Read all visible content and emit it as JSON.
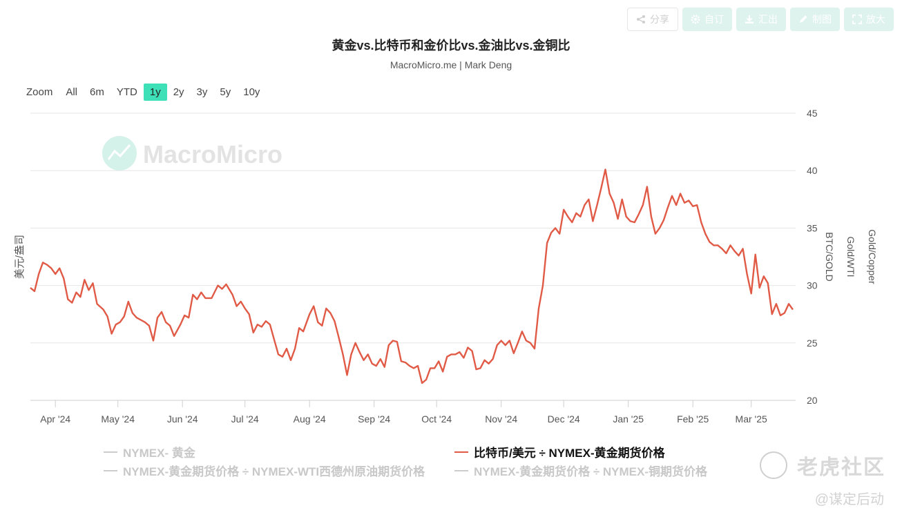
{
  "toolbar": {
    "share": "分享",
    "subscribe": "自订",
    "export": "汇出",
    "edit": "制图",
    "enlarge": "放大"
  },
  "title": "黄金vs.比特币和金价比vs.金油比vs.金铜比",
  "subtitle": "MacroMicro.me | Mark Deng",
  "zoom": {
    "label": "Zoom",
    "options": [
      "All",
      "6m",
      "YTD",
      "1y",
      "2y",
      "3y",
      "5y",
      "10y"
    ],
    "active": "1y"
  },
  "watermark": "MacroMicro",
  "legend": {
    "gold": "NYMEX- 黄金",
    "btc_gold": "比特币/美元 ÷ NYMEX-黄金期货价格",
    "gold_wti": "NYMEX-黄金期货价格 ÷ NYMEX-WTI西德州原油期货价格",
    "gold_copper": "NYMEX-黄金期货价格 ÷ NYMEX-铜期货价格"
  },
  "community": {
    "name": "老虎社区",
    "handle": "@谋定后动"
  },
  "chart_data": {
    "type": "line",
    "ylabel_left": "美元/盎司",
    "ylabels_right": [
      "BTC/GOLD",
      "Gold/WTI",
      "Gold/Copper"
    ],
    "ylim": [
      20,
      45
    ],
    "yticks": [
      20,
      25,
      30,
      35,
      40,
      45
    ],
    "x_ticks": [
      "Apr '24",
      "May '24",
      "Jun '24",
      "Jul '24",
      "Aug '24",
      "Sep '24",
      "Oct '24",
      "Nov '24",
      "Dec '24",
      "Jan '25",
      "Feb '25",
      "Mar '25"
    ],
    "grid": true,
    "line_color": "#e05a46",
    "series": [
      {
        "name": "比特币/美元 ÷ NYMEX-黄金期货价格",
        "points": [
          [
            "2024-03-20",
            29.8
          ],
          [
            "2024-03-22",
            29.5
          ],
          [
            "2024-03-24",
            31.0
          ],
          [
            "2024-03-26",
            32.0
          ],
          [
            "2024-03-28",
            31.8
          ],
          [
            "2024-03-30",
            31.5
          ],
          [
            "2024-04-01",
            31.0
          ],
          [
            "2024-04-03",
            31.5
          ],
          [
            "2024-04-05",
            30.6
          ],
          [
            "2024-04-07",
            28.8
          ],
          [
            "2024-04-09",
            28.5
          ],
          [
            "2024-04-11",
            29.4
          ],
          [
            "2024-04-13",
            29.0
          ],
          [
            "2024-04-15",
            30.5
          ],
          [
            "2024-04-17",
            29.6
          ],
          [
            "2024-04-19",
            30.2
          ],
          [
            "2024-04-21",
            28.4
          ],
          [
            "2024-04-24",
            27.9
          ],
          [
            "2024-04-26",
            27.3
          ],
          [
            "2024-04-28",
            25.8
          ],
          [
            "2024-04-30",
            26.6
          ],
          [
            "2024-05-02",
            26.8
          ],
          [
            "2024-05-04",
            27.3
          ],
          [
            "2024-05-06",
            28.6
          ],
          [
            "2024-05-08",
            27.6
          ],
          [
            "2024-05-10",
            27.2
          ],
          [
            "2024-05-12",
            27.0
          ],
          [
            "2024-05-14",
            26.8
          ],
          [
            "2024-05-16",
            26.5
          ],
          [
            "2024-05-18",
            25.2
          ],
          [
            "2024-05-20",
            27.2
          ],
          [
            "2024-05-22",
            27.7
          ],
          [
            "2024-05-24",
            26.8
          ],
          [
            "2024-05-26",
            26.5
          ],
          [
            "2024-05-28",
            25.6
          ],
          [
            "2024-05-31",
            26.6
          ],
          [
            "2024-06-02",
            27.4
          ],
          [
            "2024-06-04",
            27.2
          ],
          [
            "2024-06-06",
            29.2
          ],
          [
            "2024-06-08",
            28.8
          ],
          [
            "2024-06-10",
            29.4
          ],
          [
            "2024-06-12",
            28.9
          ],
          [
            "2024-06-15",
            28.9
          ],
          [
            "2024-06-18",
            30.0
          ],
          [
            "2024-06-20",
            29.7
          ],
          [
            "2024-06-22",
            30.1
          ],
          [
            "2024-06-25",
            29.2
          ],
          [
            "2024-06-27",
            28.2
          ],
          [
            "2024-06-29",
            28.6
          ],
          [
            "2024-07-01",
            28.0
          ],
          [
            "2024-07-03",
            27.5
          ],
          [
            "2024-07-05",
            25.9
          ],
          [
            "2024-07-07",
            26.6
          ],
          [
            "2024-07-09",
            26.4
          ],
          [
            "2024-07-11",
            26.9
          ],
          [
            "2024-07-13",
            26.6
          ],
          [
            "2024-07-15",
            25.3
          ],
          [
            "2024-07-17",
            24.0
          ],
          [
            "2024-07-19",
            23.8
          ],
          [
            "2024-07-21",
            24.5
          ],
          [
            "2024-07-23",
            23.5
          ],
          [
            "2024-07-25",
            24.5
          ],
          [
            "2024-07-27",
            26.3
          ],
          [
            "2024-07-29",
            26.0
          ],
          [
            "2024-08-01",
            27.5
          ],
          [
            "2024-08-03",
            28.2
          ],
          [
            "2024-08-05",
            26.8
          ],
          [
            "2024-08-07",
            26.5
          ],
          [
            "2024-08-09",
            28.0
          ],
          [
            "2024-08-11",
            27.6
          ],
          [
            "2024-08-13",
            26.9
          ],
          [
            "2024-08-15",
            25.5
          ],
          [
            "2024-08-17",
            24.0
          ],
          [
            "2024-08-19",
            22.2
          ],
          [
            "2024-08-21",
            24.0
          ],
          [
            "2024-08-23",
            25.0
          ],
          [
            "2024-08-25",
            24.2
          ],
          [
            "2024-08-27",
            23.5
          ],
          [
            "2024-08-29",
            24.0
          ],
          [
            "2024-08-31",
            23.2
          ],
          [
            "2024-09-02",
            23.0
          ],
          [
            "2024-09-04",
            23.6
          ],
          [
            "2024-09-06",
            22.9
          ],
          [
            "2024-09-08",
            24.8
          ],
          [
            "2024-09-10",
            25.2
          ],
          [
            "2024-09-12",
            25.1
          ],
          [
            "2024-09-14",
            23.4
          ],
          [
            "2024-09-16",
            23.3
          ],
          [
            "2024-09-18",
            23.0
          ],
          [
            "2024-09-20",
            22.8
          ],
          [
            "2024-09-22",
            23.0
          ],
          [
            "2024-09-24",
            21.5
          ],
          [
            "2024-09-26",
            21.8
          ],
          [
            "2024-09-28",
            22.8
          ],
          [
            "2024-09-30",
            22.8
          ],
          [
            "2024-10-02",
            23.4
          ],
          [
            "2024-10-04",
            22.5
          ],
          [
            "2024-10-06",
            23.8
          ],
          [
            "2024-10-08",
            24.0
          ],
          [
            "2024-10-10",
            24.0
          ],
          [
            "2024-10-12",
            24.2
          ],
          [
            "2024-10-14",
            23.7
          ],
          [
            "2024-10-16",
            24.6
          ],
          [
            "2024-10-18",
            24.3
          ],
          [
            "2024-10-20",
            22.7
          ],
          [
            "2024-10-22",
            22.8
          ],
          [
            "2024-10-24",
            23.5
          ],
          [
            "2024-10-26",
            23.2
          ],
          [
            "2024-10-28",
            23.6
          ],
          [
            "2024-10-30",
            24.8
          ],
          [
            "2024-11-01",
            25.2
          ],
          [
            "2024-11-03",
            24.8
          ],
          [
            "2024-11-05",
            25.2
          ],
          [
            "2024-11-07",
            24.1
          ],
          [
            "2024-11-09",
            25.0
          ],
          [
            "2024-11-11",
            26.0
          ],
          [
            "2024-11-13",
            25.2
          ],
          [
            "2024-11-15",
            25.0
          ],
          [
            "2024-11-17",
            24.5
          ],
          [
            "2024-11-19",
            28.0
          ],
          [
            "2024-11-21",
            30.0
          ],
          [
            "2024-11-23",
            33.7
          ],
          [
            "2024-11-25",
            34.6
          ],
          [
            "2024-11-27",
            35.0
          ],
          [
            "2024-11-29",
            34.5
          ],
          [
            "2024-12-01",
            36.6
          ],
          [
            "2024-12-03",
            36.0
          ],
          [
            "2024-12-05",
            35.5
          ],
          [
            "2024-12-07",
            36.3
          ],
          [
            "2024-12-09",
            36.0
          ],
          [
            "2024-12-11",
            37.0
          ],
          [
            "2024-12-13",
            37.5
          ],
          [
            "2024-12-15",
            35.6
          ],
          [
            "2024-12-17",
            37.0
          ],
          [
            "2024-12-19",
            38.5
          ],
          [
            "2024-12-21",
            40.1
          ],
          [
            "2024-12-23",
            38.0
          ],
          [
            "2024-12-25",
            37.2
          ],
          [
            "2024-12-27",
            35.8
          ],
          [
            "2024-12-29",
            37.5
          ],
          [
            "2024-12-31",
            36.0
          ],
          [
            "2025-01-02",
            35.6
          ],
          [
            "2025-01-04",
            35.5
          ],
          [
            "2025-01-06",
            36.2
          ],
          [
            "2025-01-08",
            37.0
          ],
          [
            "2025-01-10",
            38.6
          ],
          [
            "2025-01-12",
            36.0
          ],
          [
            "2025-01-14",
            34.5
          ],
          [
            "2025-01-16",
            35.0
          ],
          [
            "2025-01-18",
            35.7
          ],
          [
            "2025-01-20",
            36.8
          ],
          [
            "2025-01-22",
            37.8
          ],
          [
            "2025-01-24",
            37.0
          ],
          [
            "2025-01-26",
            38.0
          ],
          [
            "2025-01-28",
            37.2
          ],
          [
            "2025-01-30",
            37.4
          ],
          [
            "2025-02-01",
            36.9
          ],
          [
            "2025-02-03",
            37.0
          ],
          [
            "2025-02-05",
            35.5
          ],
          [
            "2025-02-07",
            34.5
          ],
          [
            "2025-02-09",
            33.8
          ],
          [
            "2025-02-11",
            33.5
          ],
          [
            "2025-02-13",
            33.5
          ],
          [
            "2025-02-15",
            33.2
          ],
          [
            "2025-02-17",
            32.8
          ],
          [
            "2025-02-19",
            33.5
          ],
          [
            "2025-02-21",
            33.0
          ],
          [
            "2025-02-23",
            32.6
          ],
          [
            "2025-02-25",
            33.2
          ],
          [
            "2025-02-27",
            31.0
          ],
          [
            "2025-03-01",
            29.3
          ],
          [
            "2025-03-03",
            32.7
          ],
          [
            "2025-03-05",
            29.8
          ],
          [
            "2025-03-07",
            30.8
          ],
          [
            "2025-03-09",
            30.2
          ],
          [
            "2025-03-11",
            27.5
          ],
          [
            "2025-03-13",
            28.4
          ],
          [
            "2025-03-15",
            27.4
          ],
          [
            "2025-03-17",
            27.6
          ],
          [
            "2025-03-19",
            28.4
          ],
          [
            "2025-03-21",
            27.9
          ]
        ]
      }
    ]
  }
}
